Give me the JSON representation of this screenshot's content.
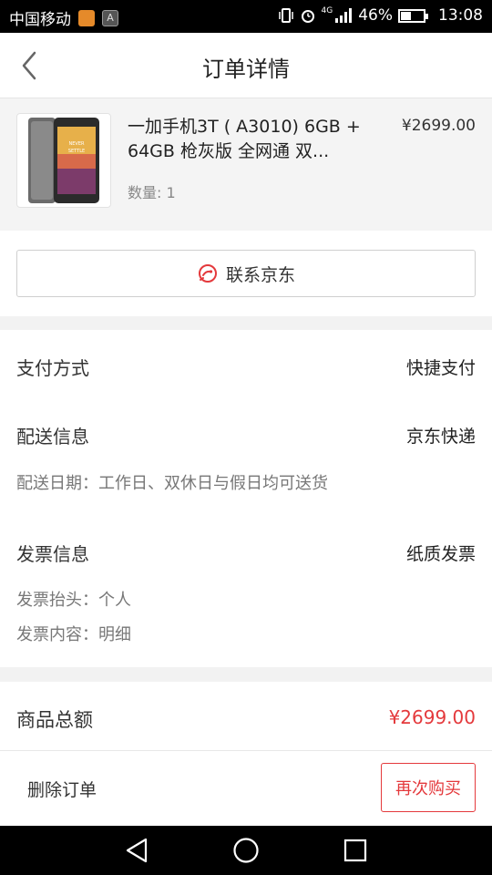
{
  "status_bar": {
    "carrier": "中国移动",
    "network": "4G",
    "battery": "46%",
    "battery_level": 0.46,
    "time": "13:08"
  },
  "header": {
    "title": "订单详情",
    "back_icon": "chevron-left-icon"
  },
  "product": {
    "name": "一加手机3T ( A3010) 6GB + 64GB 枪灰版 全网通 双...",
    "price": "¥2699.00",
    "quantity": "数量: 1",
    "thumb_text": "NEVER SETTLE"
  },
  "contact": {
    "label": "联系京东",
    "icon": "chat-icon"
  },
  "order_info": {
    "payment_label": "支付方式",
    "payment_value": "快捷支付",
    "delivery_label": "配送信息",
    "delivery_value": "京东快递",
    "delivery_date": "配送日期：工作日、双休日与假日均可送货",
    "invoice_label": "发票信息",
    "invoice_value": "纸质发票",
    "invoice_title": "发票抬头：个人",
    "invoice_content": "发票内容：明细"
  },
  "total": {
    "label": "商品总额",
    "amount": "¥2699.00"
  },
  "actions": {
    "delete": "删除订单",
    "rebuy": "再次购买"
  },
  "colors": {
    "accent": "#e4393c"
  }
}
